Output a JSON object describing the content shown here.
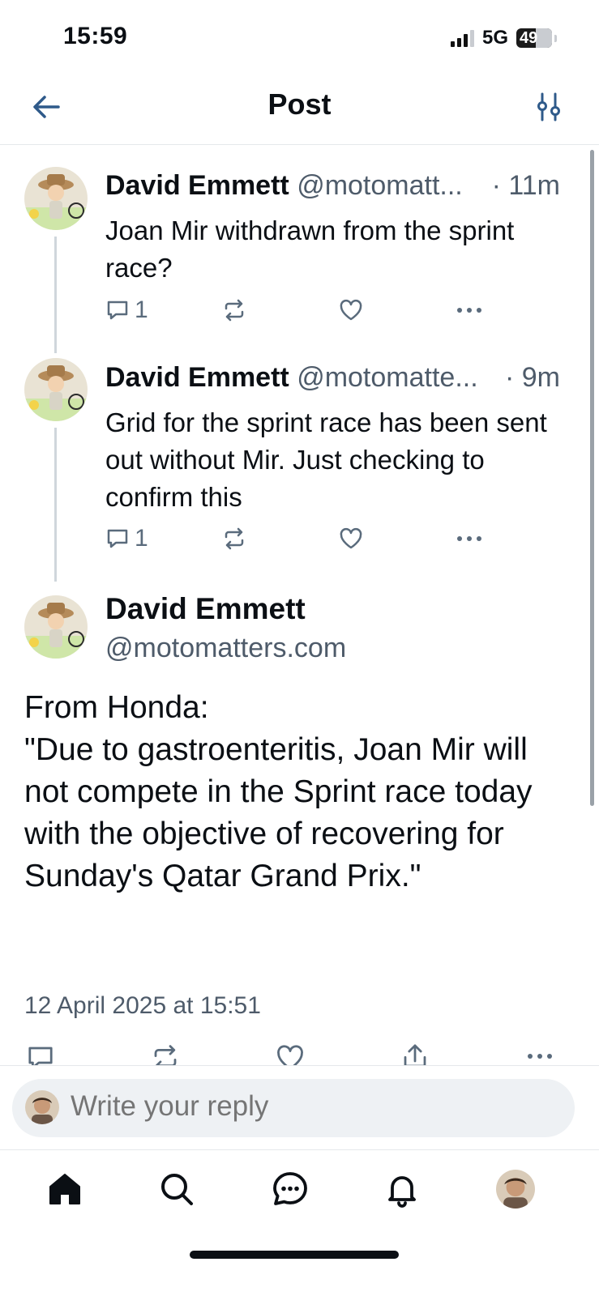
{
  "status_bar": {
    "time": "15:59",
    "network": "5G",
    "battery": "49"
  },
  "header": {
    "title": "Post"
  },
  "thread": [
    {
      "name": "David Emmett",
      "handle": "@motomatt...",
      "time": "· 11m",
      "text": "Joan Mir withdrawn from the sprint race?",
      "reply_count": "1"
    },
    {
      "name": "David Emmett",
      "handle": "@motomatte...",
      "time": "· 9m",
      "text": "Grid for the sprint race has been sent out without Mir. Just checking to confirm this",
      "reply_count": "1"
    }
  ],
  "main_post": {
    "name": "David Emmett",
    "handle": "@motomatters.com",
    "text": "From Honda:\n\"Due to gastroenteritis, Joan Mir will not compete in the Sprint race today with the objective of recovering for Sunday's Qatar Grand Prix.\"",
    "date": "12 April 2025 at 15:51"
  },
  "reply": {
    "placeholder": "Write your reply"
  },
  "colors": {
    "accent": "#1d4ed8",
    "muted": "#4e5b6a",
    "icon": "#5a6b7c"
  },
  "tabs": [
    "home-icon",
    "search-icon",
    "chat-icon",
    "bell-icon",
    "profile-avatar"
  ]
}
